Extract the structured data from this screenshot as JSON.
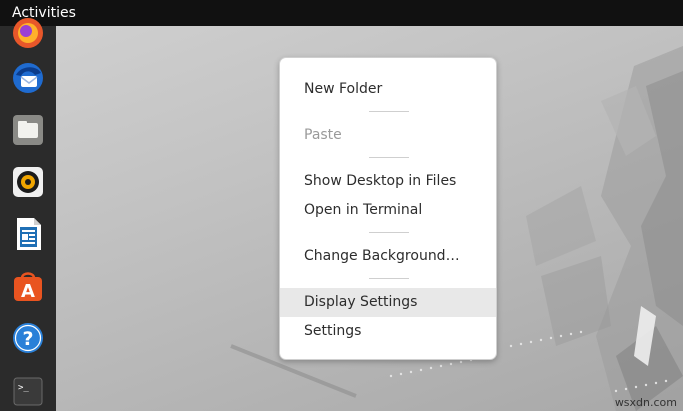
{
  "topbar": {
    "activities_label": "Activities"
  },
  "dock": {
    "items": [
      {
        "name": "firefox",
        "icon": "firefox-icon"
      },
      {
        "name": "thunderbird",
        "icon": "thunderbird-icon"
      },
      {
        "name": "files",
        "icon": "folder-icon"
      },
      {
        "name": "rhythmbox",
        "icon": "speaker-icon"
      },
      {
        "name": "libreoffice-writer",
        "icon": "document-icon"
      },
      {
        "name": "ubuntu-software",
        "icon": "software-bag-icon"
      },
      {
        "name": "help",
        "icon": "help-icon"
      },
      {
        "name": "terminal",
        "icon": "terminal-icon"
      }
    ],
    "terminal_prompt": ">_",
    "help_glyph": "?",
    "software_glyph": "A"
  },
  "context_menu": {
    "items": [
      {
        "label": "New Folder",
        "enabled": true
      },
      {
        "label": "Paste",
        "enabled": false
      },
      {
        "label": "Show Desktop in Files",
        "enabled": true
      },
      {
        "label": "Open in Terminal",
        "enabled": true
      },
      {
        "label": "Change Background…",
        "enabled": true
      },
      {
        "label": "Display Settings",
        "enabled": true,
        "highlighted": true
      },
      {
        "label": "Settings",
        "enabled": true
      }
    ]
  },
  "watermark": "wsxdn.com",
  "colors": {
    "topbar": "#111111",
    "dock": "#2b2b2b",
    "menu_bg": "#ffffff",
    "menu_highlight": "#e8e8e8",
    "disabled_text": "#9a9a9a"
  }
}
